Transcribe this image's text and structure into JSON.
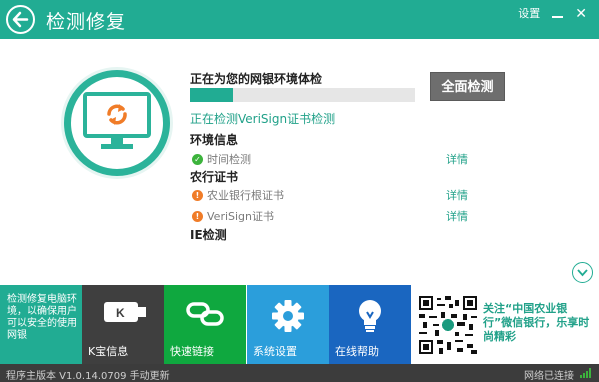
{
  "header": {
    "title": "检测修复",
    "settings_label": "设置"
  },
  "scan": {
    "title": "正在为您的网银环境体检",
    "progress_fraction": 0.19,
    "button_label": "全面检测",
    "status": "正在检测VeriSign证书检测"
  },
  "sections": {
    "env": {
      "title": "环境信息",
      "items": [
        {
          "label": "时间检测",
          "status": "ok",
          "detail": "详情"
        }
      ]
    },
    "cert": {
      "title": "农行证书",
      "items": [
        {
          "label": "农业银行根证书",
          "status": "warning",
          "detail": "详情"
        },
        {
          "label": "VeriSign证书",
          "status": "warning",
          "detail": "详情"
        }
      ]
    },
    "ie": {
      "title": "IE检测"
    }
  },
  "bottom": {
    "tip": "检测修复电脑环境，以确保用户可以安全的使用网银",
    "tiles": [
      {
        "label": "K宝信息",
        "icon": "kbao-icon"
      },
      {
        "label": "快速链接",
        "icon": "link-icon"
      },
      {
        "label": "系统设置",
        "icon": "gear-icon"
      },
      {
        "label": "在线帮助",
        "icon": "lightbulb-icon"
      }
    ],
    "qr_text": "关注“中国农业银行”微信银行，乐享时尚精彩"
  },
  "footer": {
    "version": "程序主版本 V1.0.14.0709 手动更新",
    "network": "网络已连接"
  },
  "colors": {
    "brand": "#21ac93",
    "warning": "#f07c28",
    "ok": "#3cb33c"
  }
}
